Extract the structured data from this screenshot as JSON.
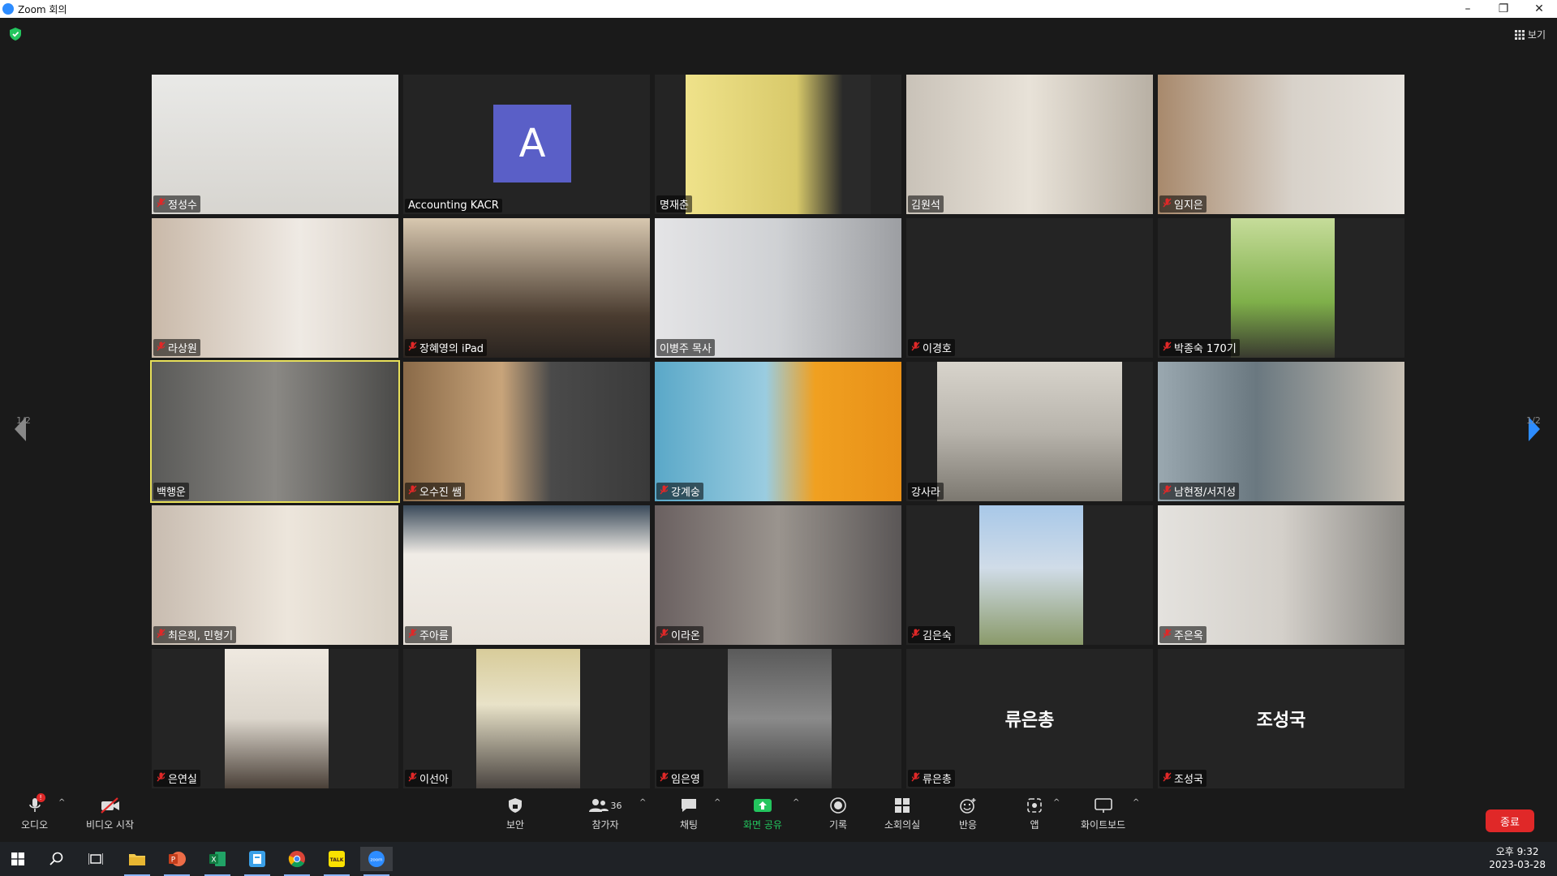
{
  "window": {
    "title": "Zoom 회의",
    "minimize": "–",
    "restore": "❐",
    "close": "✕"
  },
  "view_button": {
    "label": "보기"
  },
  "pager": {
    "left": "1/2",
    "right": "1/2"
  },
  "tiles": [
    {
      "name": "정성수",
      "muted": true
    },
    {
      "name": "Accounting KACR",
      "muted": false,
      "avatar_letter": "A"
    },
    {
      "name": "명재춘",
      "muted": false
    },
    {
      "name": "김원석",
      "muted": false
    },
    {
      "name": "임지은",
      "muted": true
    },
    {
      "name": "라상원",
      "muted": true
    },
    {
      "name": "장혜영의 iPad",
      "muted": true
    },
    {
      "name": "이병주 목사",
      "muted": false
    },
    {
      "name": "이경호",
      "muted": true
    },
    {
      "name": "박종숙 170기",
      "muted": true
    },
    {
      "name": "백행운",
      "muted": false,
      "active": true
    },
    {
      "name": "오수진 쌤",
      "muted": true
    },
    {
      "name": "강계숭",
      "muted": true
    },
    {
      "name": "강사라",
      "muted": false
    },
    {
      "name": "남현정/서지성",
      "muted": true
    },
    {
      "name": "최은희, 민형기",
      "muted": true
    },
    {
      "name": "주아름",
      "muted": true
    },
    {
      "name": "이라온",
      "muted": true
    },
    {
      "name": "김은숙",
      "muted": true
    },
    {
      "name": "주은옥",
      "muted": true
    },
    {
      "name": "은연실",
      "muted": true
    },
    {
      "name": "이선아",
      "muted": true
    },
    {
      "name": "임은영",
      "muted": true
    },
    {
      "name": "류은총",
      "muted": true,
      "display_name": "류은총"
    },
    {
      "name": "조성국",
      "muted": true,
      "display_name": "조성국"
    }
  ],
  "toolbar": {
    "audio": "오디오",
    "video": "비디오 시작",
    "security": "보안",
    "participants": "참가자",
    "participants_count": "36",
    "chat": "채팅",
    "share": "화면 공유",
    "record": "기록",
    "breakout": "소회의실",
    "reactions": "반응",
    "apps": "앱",
    "whiteboard": "화이트보드",
    "end": "종료"
  },
  "taskbar": {
    "time": "오후 9:32",
    "date": "2023-03-28"
  },
  "colors": {
    "accent": "#2d8cff",
    "end": "#e02828",
    "active_speaker": "#e8e05a",
    "share_green": "#23c55e"
  }
}
